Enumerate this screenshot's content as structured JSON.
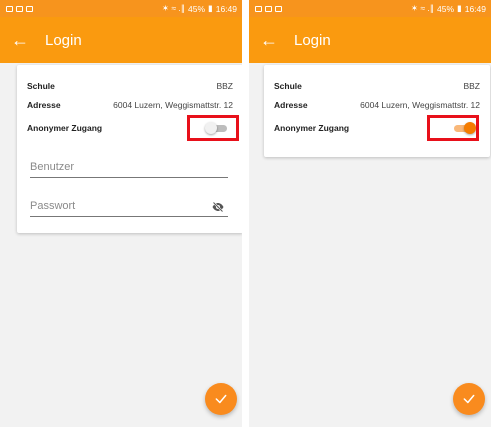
{
  "statusbar": {
    "signal": "✶ ≈ .∥",
    "battery": "45%",
    "time": "16:49"
  },
  "appbar": {
    "back_icon": "←",
    "title": "Login"
  },
  "card": {
    "school_label": "Schule",
    "school_value": "BBZ",
    "address_label": "Adresse",
    "address_value": "6004 Luzern, Weggismattstr. 12",
    "anon_label": "Anonymer Zugang"
  },
  "form": {
    "user_placeholder": "Benutzer",
    "password_placeholder": "Passwort"
  },
  "colors": {
    "accent": "#fa9a0f",
    "highlight": "#e8101a",
    "toggle_on": "#f57c00"
  },
  "toggle_states": {
    "left": "off",
    "right": "on"
  },
  "icons": [
    "back-arrow-icon",
    "eye-off-icon",
    "checkmark-icon"
  ]
}
